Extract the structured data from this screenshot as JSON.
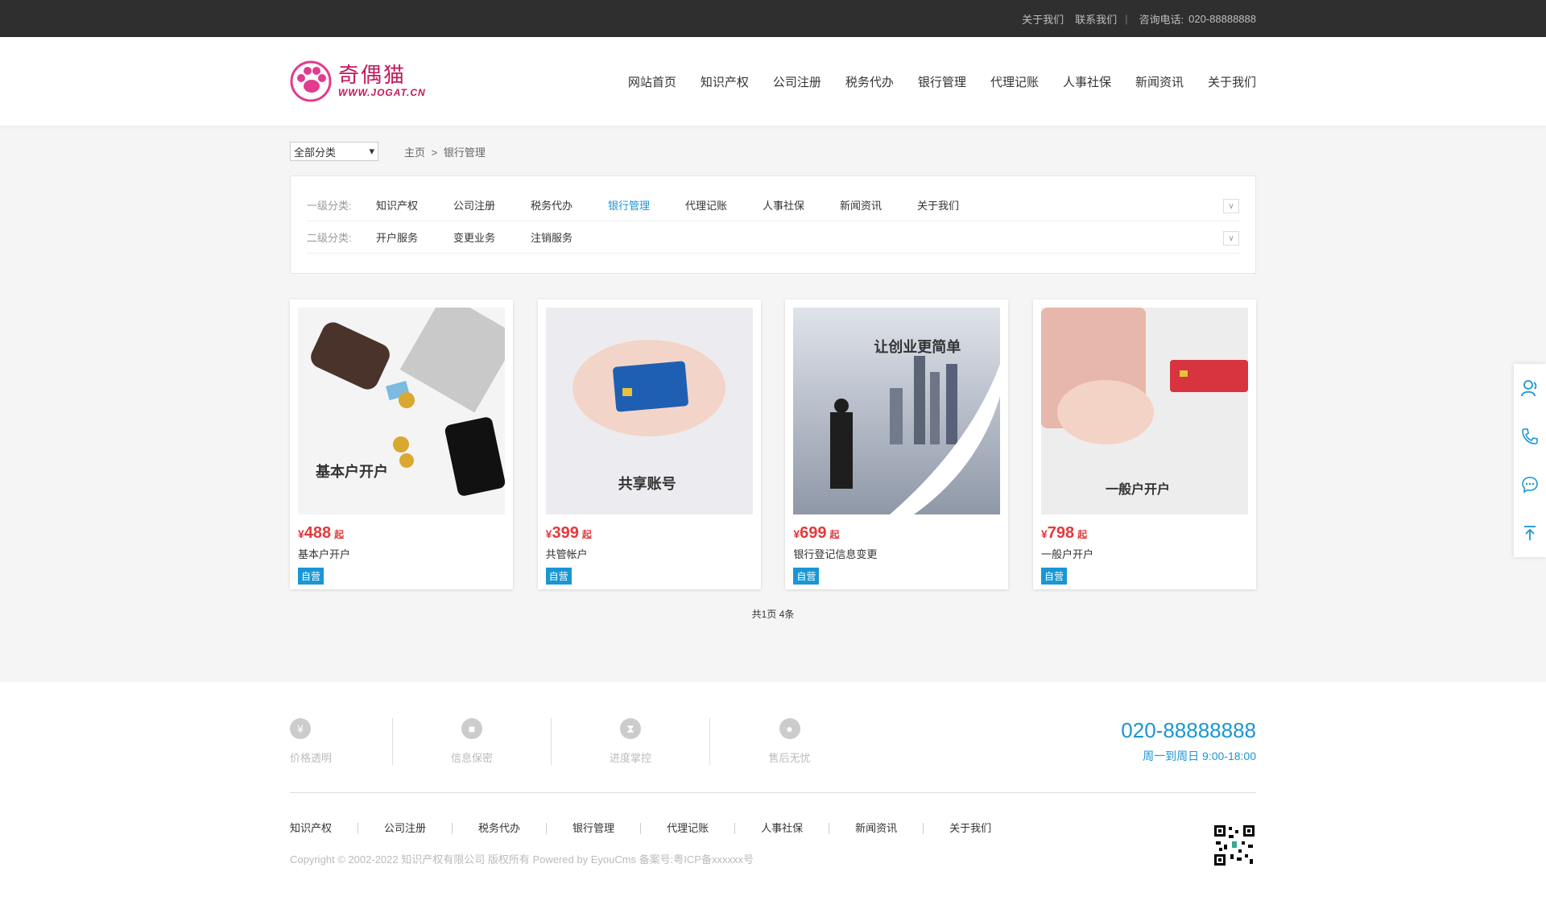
{
  "topbar": {
    "about": "关于我们",
    "contact": "联系我们",
    "sep": "|",
    "phone_label": "咨询电话:",
    "phone": "020-88888888"
  },
  "logo": {
    "cn": "奇偶猫",
    "url": "WWW.JOGAT.CN"
  },
  "nav": [
    "网站首页",
    "知识产权",
    "公司注册",
    "税务代办",
    "银行管理",
    "代理记账",
    "人事社保",
    "新闻资讯",
    "关于我们"
  ],
  "category_select": {
    "value": "全部分类"
  },
  "breadcrumb": {
    "home": "主页",
    "sep": ">",
    "current": "银行管理"
  },
  "filter": {
    "level1_label": "一级分类:",
    "level1_items": [
      "知识产权",
      "公司注册",
      "税务代办",
      "银行管理",
      "代理记账",
      "人事社保",
      "新闻资讯",
      "关于我们"
    ],
    "level1_active": "银行管理",
    "level2_label": "二级分类:",
    "level2_items": [
      "开户服务",
      "变更业务",
      "注销服务"
    ]
  },
  "products": [
    {
      "caption": "基本户开户",
      "price": "488",
      "name": "基本户开户",
      "tag": "自营"
    },
    {
      "caption": "共享账号",
      "price": "399",
      "name": "共管帐户",
      "tag": "自营"
    },
    {
      "caption": "让创业更简单",
      "price": "699",
      "name": "银行登记信息变更",
      "tag": "自营"
    },
    {
      "caption": "一般户开户",
      "price": "798",
      "name": "一般户开户",
      "tag": "自营"
    }
  ],
  "price_prefix": "¥",
  "price_suffix": "起",
  "pager": "共1页 4条",
  "footer": {
    "features": [
      {
        "icon": "yen-icon",
        "label": "价格透明"
      },
      {
        "icon": "lock-icon",
        "label": "信息保密"
      },
      {
        "icon": "hourglass-icon",
        "label": "进度掌控"
      },
      {
        "icon": "support-icon",
        "label": "售后无忧"
      }
    ],
    "phone": "020-88888888",
    "hours": "周一到周日 9:00-18:00",
    "links": [
      "知识产权",
      "公司注册",
      "税务代办",
      "银行管理",
      "代理记账",
      "人事社保",
      "新闻资讯",
      "关于我们"
    ],
    "copyright": "Copyright © 2002-2022 知识产权有限公司 版权所有 Powered by EyouCms 备案号:粤ICP备xxxxxx号"
  },
  "colors": {
    "accent": "#1a96d4",
    "price": "#e4393c",
    "brand": "#c2185b",
    "topbar": "#2f2f2f"
  }
}
